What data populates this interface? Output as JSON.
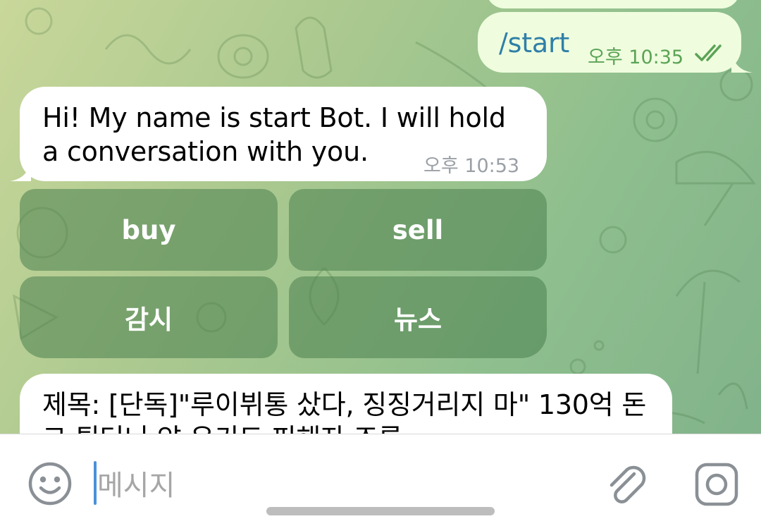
{
  "chat": {
    "messages": [
      {
        "id": "out1",
        "text": "/start",
        "time": "오후 10:35",
        "status": "read-double-check-icon"
      },
      {
        "id": "in1",
        "text": "Hi! My name is start Bot. I will hold a conversation with you.",
        "time": "오후 10:53"
      },
      {
        "id": "in2",
        "text": "제목: [단독]\"루이뷔통 샀다, 징징거리지 마\" 130억 돈그 튀더니 얀 유키드 피해자 조롱"
      }
    ],
    "keyboard": {
      "buttons": [
        {
          "label": "buy"
        },
        {
          "label": "sell"
        },
        {
          "label": "감시"
        },
        {
          "label": "뉴스"
        }
      ]
    }
  },
  "composer": {
    "placeholder": "메시지",
    "emoji_icon": "smiley-icon",
    "attach_icon": "paperclip-icon",
    "camera_icon": "instagram-camera-icon"
  },
  "colors": {
    "outgoing_bubble": "#effdde",
    "incoming_bubble": "#ffffff",
    "accent": "#2f7fa8",
    "check": "#5ba356"
  }
}
